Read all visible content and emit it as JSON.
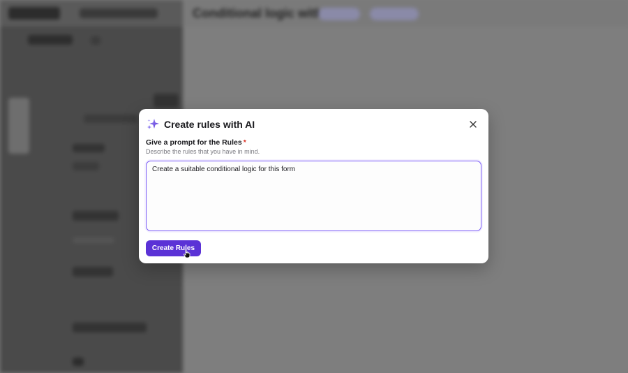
{
  "background": {
    "doc_title": "Conditional logic with AI",
    "tab_a": "",
    "tab_b": ""
  },
  "modal": {
    "title": "Create rules with AI",
    "field_label": "Give a prompt for the Rules",
    "required_mark": "*",
    "field_hint": "Describe the rules that you have in mind.",
    "prompt_value": "Create a suitable conditional logic for this form",
    "submit_label": "Create Rules"
  },
  "colors": {
    "accent": "#5b32d6",
    "focus_border": "#7a5af8",
    "required": "#d92d20",
    "overlay": "#7d7d7d"
  },
  "icons": {
    "title_icon": "sparkle-icon",
    "close": "close-icon",
    "pointer": "mouse-cursor-icon"
  }
}
